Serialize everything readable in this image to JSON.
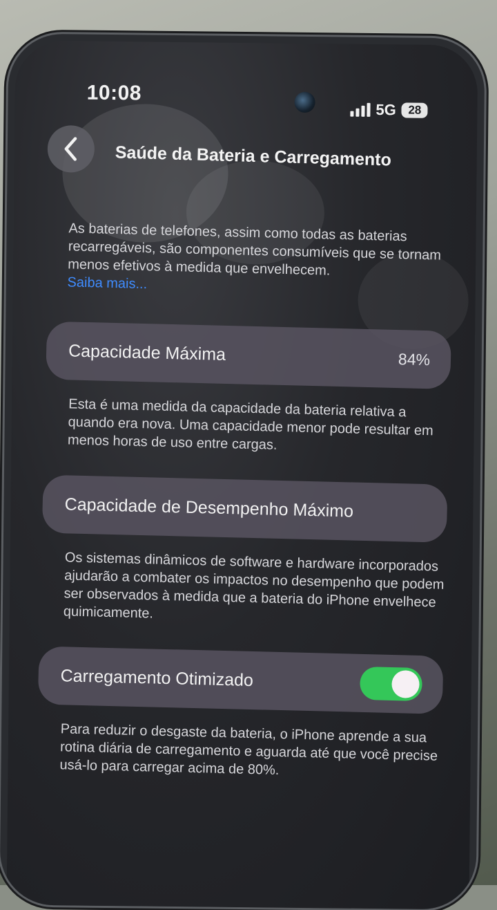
{
  "status_bar": {
    "time": "10:08",
    "network": "5G",
    "battery_level": "28"
  },
  "nav": {
    "back_icon": "chevron-left-icon",
    "title": "Saúde da Bateria e Carregamento"
  },
  "intro": {
    "text": "As baterias de telefones, assim como todas as baterias recarregáveis, são componentes consumíveis que se tornam menos efetivos à medida que envelhecem.",
    "link": "Saiba mais..."
  },
  "max_capacity": {
    "label": "Capacidade Máxima",
    "value": "84%",
    "description": "Esta é uma medida da capacidade da bateria relativa a quando era nova. Uma capacidade menor pode resultar em menos horas de uso entre cargas."
  },
  "peak_performance": {
    "label": "Capacidade de Desempenho Máximo",
    "description": "Os sistemas dinâmicos de software e hardware incorporados ajudarão a combater os impactos no desempenho que podem ser observados à medida que a bateria do iPhone envelhece quimicamente."
  },
  "optimized_charging": {
    "label": "Carregamento Otimizado",
    "enabled": true,
    "description": "Para reduzir o desgaste da bateria, o iPhone aprende a sua rotina diária de carregamento e aguarda até que você precise usá-lo para carregar acima de 80%."
  },
  "colors": {
    "accent_link": "#3f8cff",
    "toggle_on": "#34c759"
  }
}
